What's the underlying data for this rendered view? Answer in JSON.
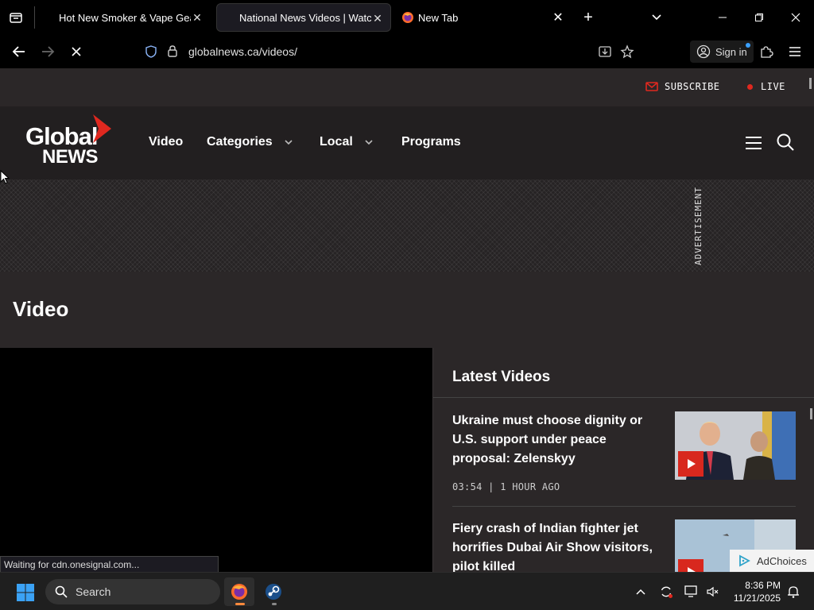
{
  "browser": {
    "tabs": [
      {
        "title": "Hot New Smoker & Vape Gear | ",
        "active": false
      },
      {
        "title": "National News Videos | Watch N",
        "active": true
      },
      {
        "title": "New Tab",
        "active": false
      }
    ],
    "url": "globalnews.ca/videos/",
    "sign_in_label": "Sign in",
    "status_text": "Waiting for cdn.onesignal.com..."
  },
  "site": {
    "subscribe_label": "SUBSCRIBE",
    "live_label": "LIVE",
    "logo_top": "Global",
    "logo_bottom": "NEWS",
    "nav": [
      {
        "label": "Video",
        "dropdown": false
      },
      {
        "label": "Categories",
        "dropdown": true
      },
      {
        "label": "Local",
        "dropdown": true
      },
      {
        "label": "Programs",
        "dropdown": false
      }
    ],
    "ad_label": "ADVERTISEMENT",
    "page_title": "Video",
    "latest_heading": "Latest Videos",
    "videos": [
      {
        "title": "Ukraine must choose dignity or U.S. support under peace proposal: Zelenskyy",
        "meta": "03:54 | 1 HOUR AGO"
      },
      {
        "title": "Fiery crash of Indian fighter jet horrifies Dubai Air Show visitors, pilot killed",
        "meta": ""
      }
    ],
    "adchoices_label": "AdChoices",
    "accent_color": "#d8281e"
  },
  "taskbar": {
    "search_placeholder": "Search",
    "time": "8:36 PM",
    "date": "11/21/2025"
  }
}
